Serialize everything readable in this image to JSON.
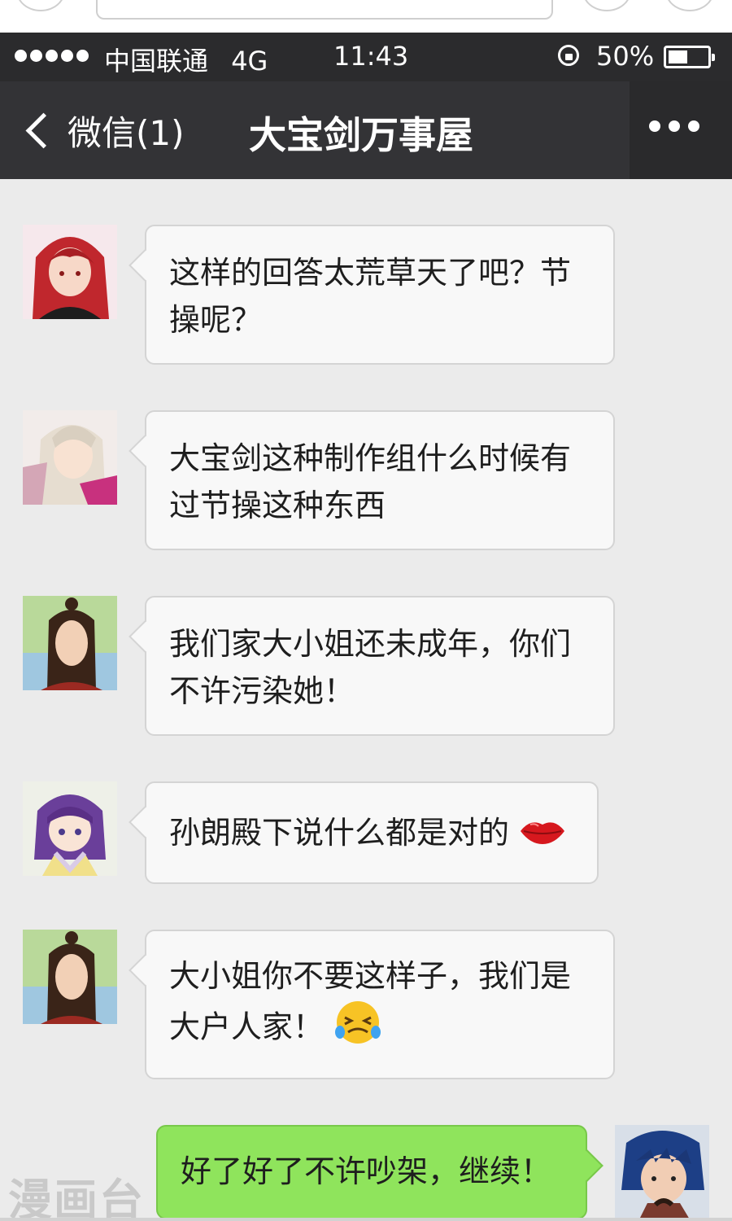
{
  "status_bar": {
    "carrier": "中国联通",
    "network": "4G",
    "time": "11:43",
    "battery": "50%",
    "battery_level": 0.5
  },
  "nav": {
    "back_label": "微信(1)",
    "title": "大宝剑万事屋",
    "more_icon": "more-dots-icon"
  },
  "messages": [
    {
      "side": "left",
      "avatar": "red-haired-girl-avatar",
      "text": "这样的回答太荒草天了吧？节操呢？"
    },
    {
      "side": "left",
      "avatar": "white-haired-lady-avatar",
      "text": "大宝剑这种制作组什么时候有过节操这种东西"
    },
    {
      "side": "left",
      "avatar": "long-haired-man-avatar",
      "text": "我们家大小姐还未成年，你们不许污染她！"
    },
    {
      "side": "left",
      "avatar": "purple-haired-girl-avatar",
      "text": "孙朗殿下说什么都是对的",
      "emoji": "lips-emoji"
    },
    {
      "side": "left",
      "avatar": "long-haired-man-avatar",
      "text": "大小姐你不要这样子，我们是大户人家！",
      "emoji": "crying-face-emoji"
    },
    {
      "side": "right",
      "avatar": "blue-haired-boy-avatar",
      "text": "好了好了不许吵架，继续！"
    }
  ],
  "watermark": "漫画台",
  "colors": {
    "status_bar_bg": "#2b2b2d",
    "nav_bg": "#333336",
    "chat_bg": "#ebebeb",
    "bubble_left": "#f8f8f8",
    "bubble_right": "#8fe45c"
  }
}
